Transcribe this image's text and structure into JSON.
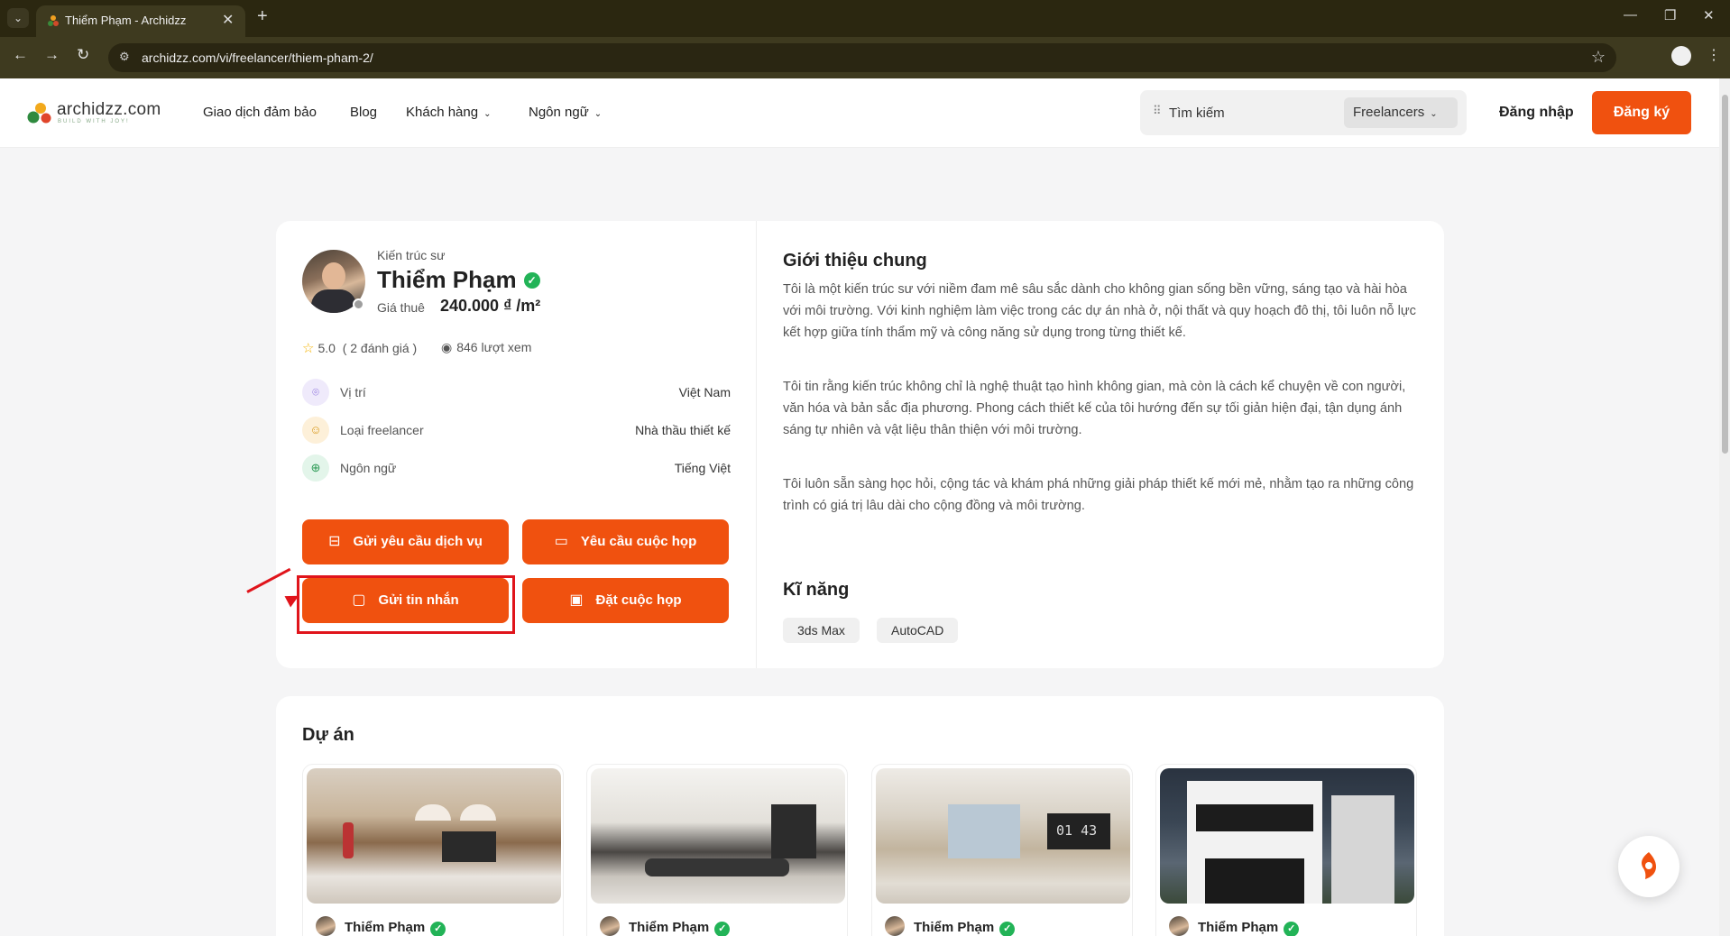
{
  "browser": {
    "tab_title": "Thiểm Phạm - Archidzz",
    "url": "archidzz.com/vi/freelancer/thiem-pham-2/"
  },
  "header": {
    "logo_text": "archidzz.com",
    "logo_tagline": "BUILD WITH JOY!",
    "nav": [
      "Giao dịch đảm bảo",
      "Blog",
      "Khách hàng",
      "Ngôn ngữ"
    ],
    "search_placeholder": "Tìm kiếm",
    "search_category": "Freelancers",
    "login": "Đăng nhập",
    "signup": "Đăng ký"
  },
  "profile": {
    "role": "Kiến trúc sư",
    "name": "Thiểm Phạm",
    "rate_label": "Giá thuê",
    "rate_value": "240.000 ₫ /m²",
    "rating": "5.0",
    "reviews": "( 2 đánh giá )",
    "views": "846 lượt xem",
    "info": [
      {
        "label": "Vị trí",
        "value": "Việt Nam",
        "icon": "location-icon"
      },
      {
        "label": "Loại freelancer",
        "value": "Nhà thầu thiết kế",
        "icon": "user-icon"
      },
      {
        "label": "Ngôn ngữ",
        "value": "Tiếng Việt",
        "icon": "globe-icon"
      }
    ],
    "actions": {
      "service_request": "Gửi yêu cầu dịch vụ",
      "meeting_request": "Yêu cầu cuộc họp",
      "send_message": "Gửi tin nhắn",
      "book_meeting": "Đặt cuộc họp"
    }
  },
  "about": {
    "title": "Giới thiệu chung",
    "paragraphs": [
      "Tôi là một kiến trúc sư với niềm đam mê sâu sắc dành cho không gian sống bền vững, sáng tạo và hài hòa với môi trường. Với kinh nghiệm làm việc trong các dự án nhà ở, nội thất và quy hoạch đô thị, tôi luôn nỗ lực kết hợp giữa tính thẩm mỹ và công năng sử dụng trong từng thiết kế.",
      "Tôi tin rằng kiến trúc không chỉ là nghệ thuật tạo hình không gian, mà còn là cách kể chuyện về con người, văn hóa và bản sắc địa phương. Phong cách thiết kế của tôi hướng đến sự tối giản hiện đại, tận dụng ánh sáng tự nhiên và vật liệu thân thiện với môi trường.",
      "Tôi luôn sẵn sàng học hỏi, cộng tác và khám phá những giải pháp thiết kế mới mẻ, nhằm tạo ra những công trình có giá trị lâu dài cho cộng đồng và môi trường."
    ],
    "skills_title": "Kĩ năng",
    "skills": [
      "3ds Max",
      "AutoCAD"
    ]
  },
  "projects": {
    "title": "Dự án",
    "items": [
      {
        "author": "Thiểm Phạm"
      },
      {
        "author": "Thiểm Phạm"
      },
      {
        "author": "Thiểm Phạm"
      },
      {
        "author": "Thiểm Phạm"
      }
    ],
    "tv_clock": "01 43"
  },
  "colors": {
    "accent": "#f0510f",
    "verified": "#22b357",
    "highlight": "#e0141b"
  }
}
